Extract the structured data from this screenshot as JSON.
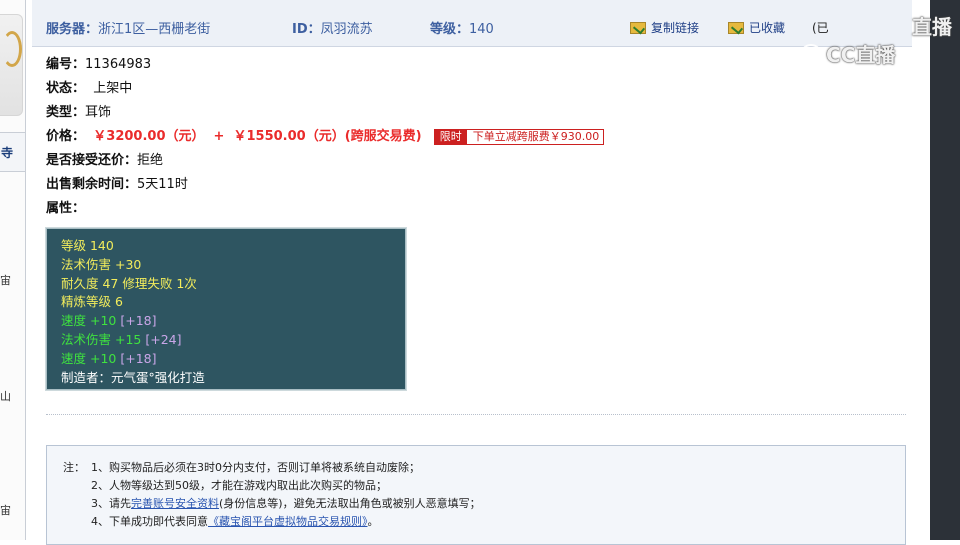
{
  "header": {
    "server_label": "服务器：",
    "server_value": "浙江1区—西栅老街",
    "id_label": "ID：",
    "id_value": "凤羽流苏",
    "level_label": "等级：",
    "level_value": "140",
    "copy_link": "复制链接",
    "favorited": "已收藏",
    "extra": "(已",
    "icons": [
      "folder-link-icon",
      "folder-favorite-icon"
    ]
  },
  "left": {
    "tab_char": "寺",
    "chars": [
      "宙",
      "山",
      "宙"
    ]
  },
  "details": {
    "code_label": "编号：",
    "code_value": "11364983",
    "status_label": "状态：",
    "status_value": "上架中",
    "type_label": "类型：",
    "type_value": "耳饰",
    "price_label": "价格：",
    "price_value": "￥3200.00（元）  +  ￥1550.00（元）(跨服交易费)",
    "limit_tag": "限时",
    "limit_text": "下单立减跨服费￥930.00",
    "counter_label": "是否接受还价：",
    "counter_value": "拒绝",
    "time_label": "出售剩余时间：",
    "time_value": "5天11时",
    "attr_label": "属性："
  },
  "attributes": [
    {
      "text": "等级 140",
      "color": "#f2ec5c"
    },
    {
      "text": "法术伤害 +30",
      "color": "#f2ec5c"
    },
    {
      "text": "耐久度 47 修理失败 1次",
      "color": "#f2ec5c"
    },
    {
      "text": "精炼等级 6",
      "color": "#f2ec5c"
    },
    {
      "text_main": "速度 +10",
      "text_extra": "[+18]"
    },
    {
      "text_main": "法术伤害 +15",
      "text_extra": "[+24]"
    },
    {
      "text_main": "速度 +10",
      "text_extra": "[+18]"
    },
    {
      "text": "制造者：元气蛋°强化打造",
      "color": "#ffffff"
    }
  ],
  "notes": {
    "prefix": "注：",
    "n1": "1、购买物品后必须在3时0分内支付，否则订单将被系统自动废除；",
    "n2": "2、人物等级达到50级，才能在游戏内取出此次购买的物品；",
    "n3_pre": "3、请先",
    "n3_link": "完善账号安全资料",
    "n3_post": "(身份信息等)，避免无法取出角色或被别人恶意填写；",
    "n4_pre": "4、下单成功即代表同意",
    "n4_link": "《藏宝阁平台虚拟物品交易规则》",
    "n4_post": "。"
  },
  "watermark": {
    "line1": "直播",
    "line2": "CC直播"
  }
}
